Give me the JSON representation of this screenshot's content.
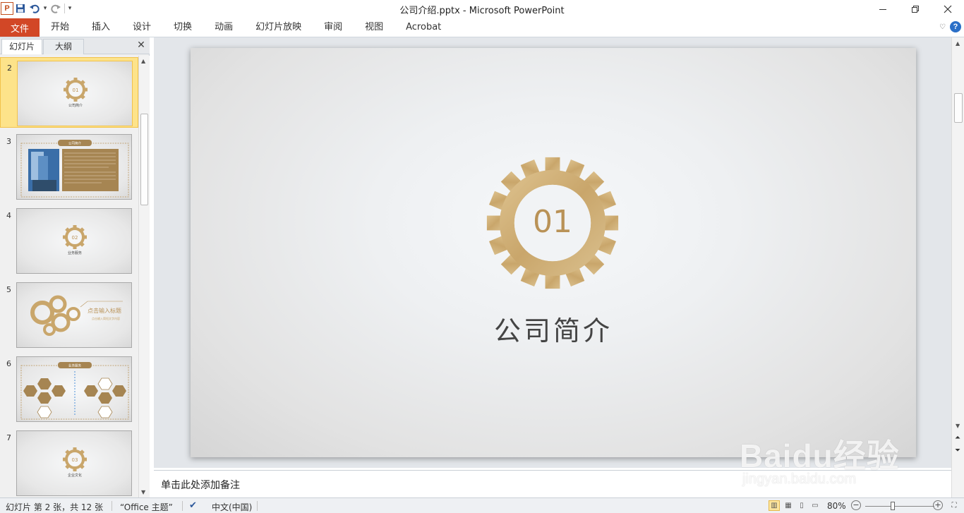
{
  "window": {
    "title": "公司介绍.pptx  -  Microsoft PowerPoint",
    "app_icon_letter": "P",
    "controls": [
      "minimize",
      "restore",
      "close"
    ]
  },
  "quick_access": {
    "items": [
      "save-icon",
      "undo-icon",
      "redo-icon",
      "customize-icon"
    ]
  },
  "ribbon": {
    "file_tab": "文件",
    "tabs": [
      "开始",
      "插入",
      "设计",
      "切换",
      "动画",
      "幻灯片放映",
      "审阅",
      "视图",
      "Acrobat"
    ],
    "help_label": "?"
  },
  "left_pane": {
    "tab_slides": "幻灯片",
    "tab_outline": "大纲",
    "close": "✕",
    "thumbnails": [
      {
        "num": "2",
        "selected": true,
        "kind": "gear",
        "gear_num": "01",
        "caption": "公司简介"
      },
      {
        "num": "3",
        "selected": false,
        "kind": "content",
        "header": "公司简介"
      },
      {
        "num": "4",
        "selected": false,
        "kind": "gear",
        "gear_num": "02",
        "caption": "业务服务"
      },
      {
        "num": "5",
        "selected": false,
        "kind": "gears",
        "title": "点击输入标题",
        "sub": "点击输入简短文字内容"
      },
      {
        "num": "6",
        "selected": false,
        "kind": "hex",
        "header": "业务服务"
      },
      {
        "num": "7",
        "selected": false,
        "kind": "gear",
        "gear_num": "03",
        "caption": "企业文化"
      }
    ]
  },
  "slide": {
    "gear_number": "01",
    "title": "公司简介",
    "accent_color": "#c9a66b"
  },
  "notes": {
    "placeholder": "单击此处添加备注"
  },
  "status_bar": {
    "slide_info": "幻灯片 第 2 张，共 12 张",
    "theme": "“Office 主题”",
    "language": "中文(中国)",
    "zoom": "80%",
    "zoom_fraction": 0.4
  },
  "watermark": {
    "main": "Baidu经验",
    "sub": "jingyan.baidu.com"
  }
}
